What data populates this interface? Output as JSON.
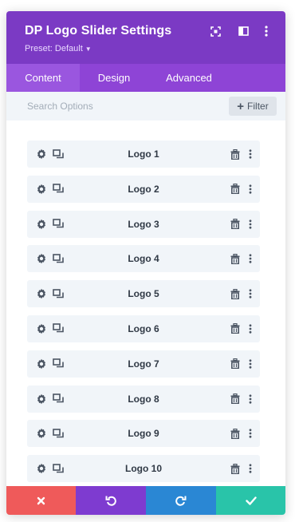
{
  "header": {
    "title": "DP Logo Slider Settings",
    "preset": "Preset: Default",
    "icons": [
      "expand-icon",
      "sidebar-toggle-icon",
      "more-vertical-icon"
    ]
  },
  "tabs": [
    {
      "label": "Content",
      "active": true
    },
    {
      "label": "Design",
      "active": false
    },
    {
      "label": "Advanced",
      "active": false
    }
  ],
  "search": {
    "placeholder": "Search Options",
    "value": "",
    "filter_label": "Filter"
  },
  "items": [
    {
      "label": "Logo 1"
    },
    {
      "label": "Logo 2"
    },
    {
      "label": "Logo 3"
    },
    {
      "label": "Logo 4"
    },
    {
      "label": "Logo 5"
    },
    {
      "label": "Logo 6"
    },
    {
      "label": "Logo 7"
    },
    {
      "label": "Logo 8"
    },
    {
      "label": "Logo 9"
    },
    {
      "label": "Logo 10"
    }
  ],
  "footer": {
    "buttons": [
      "cancel-icon",
      "undo-icon",
      "redo-icon",
      "save-check-icon"
    ]
  },
  "colors": {
    "header": "#7b3ac4",
    "tabs": "#8e44d6",
    "cancel": "#ef5a5a",
    "undo": "#7e3bd0",
    "redo": "#2a87d4",
    "save": "#29c4a9"
  }
}
